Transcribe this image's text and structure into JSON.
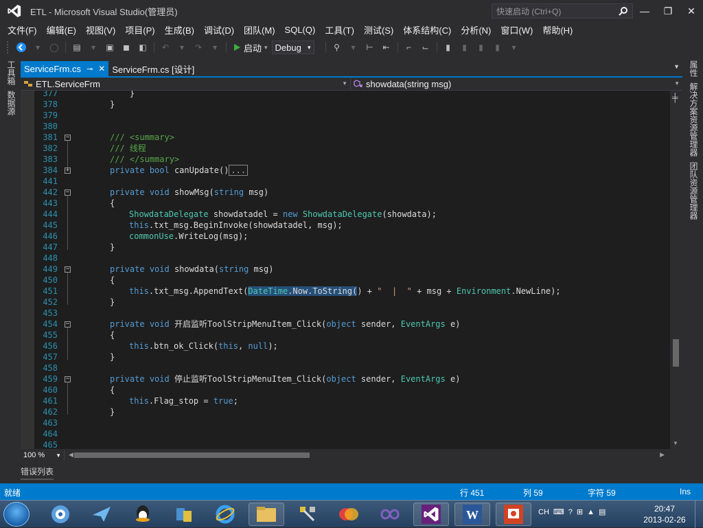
{
  "window": {
    "title": "ETL - Microsoft Visual Studio(管理员)",
    "quick_launch_placeholder": "快速启动 (Ctrl+Q)"
  },
  "menu": [
    "文件(F)",
    "编辑(E)",
    "视图(V)",
    "项目(P)",
    "生成(B)",
    "调试(D)",
    "团队(M)",
    "SQL(Q)",
    "工具(T)",
    "测试(S)",
    "体系结构(C)",
    "分析(N)",
    "窗口(W)",
    "帮助(H)"
  ],
  "toolbar": {
    "start_label": "启动",
    "config": "Debug"
  },
  "left_panels": [
    "工具箱",
    "数据源"
  ],
  "right_panels": [
    "属性",
    "解决方案资源管理器",
    "团队资源管理器"
  ],
  "tabs": [
    {
      "label": "ServiceFrm.cs",
      "active": true
    },
    {
      "label": "ServiceFrm.cs [设计]",
      "active": false
    }
  ],
  "nav": {
    "type": "ETL.ServiceFrm",
    "member": "showdata(string msg)"
  },
  "editor": {
    "lines": [
      {
        "n": "377",
        "code": "    }"
      },
      {
        "n": "378",
        "code": "}"
      },
      {
        "n": "379",
        "code": ""
      },
      {
        "n": "380",
        "code": ""
      },
      {
        "n": "381",
        "code": "/// <summary>"
      },
      {
        "n": "382",
        "code": "/// 线程"
      },
      {
        "n": "383",
        "code": "/// </summary>"
      },
      {
        "n": "384",
        "code": "private bool canUpdate()..."
      },
      {
        "n": "441",
        "code": ""
      },
      {
        "n": "442",
        "code": "private void showMsg(string msg)"
      },
      {
        "n": "443",
        "code": "{"
      },
      {
        "n": "444",
        "code": "ShowdataDelegate showdatadel = new ShowdataDelegate(showdata);"
      },
      {
        "n": "445",
        "code": "this.txt_msg.BeginInvoke(showdatadel, msg);"
      },
      {
        "n": "446",
        "code": "commonUse.WriteLog(msg);"
      },
      {
        "n": "447",
        "code": "}"
      },
      {
        "n": "448",
        "code": ""
      },
      {
        "n": "449",
        "code": "private void showdata(string msg)"
      },
      {
        "n": "450",
        "code": "{"
      },
      {
        "n": "451",
        "code": "this.txt_msg.AppendText(DateTime.Now.ToString() + \"  |  \" + msg + Environment.NewLine);"
      },
      {
        "n": "452",
        "code": "}"
      },
      {
        "n": "453",
        "code": ""
      },
      {
        "n": "454",
        "code": "private void 开启监听ToolStripMenuItem_Click(object sender, EventArgs e)"
      },
      {
        "n": "455",
        "code": "{"
      },
      {
        "n": "456",
        "code": "this.btn_ok_Click(this, null);"
      },
      {
        "n": "457",
        "code": "}"
      },
      {
        "n": "458",
        "code": ""
      },
      {
        "n": "459",
        "code": "private void 停止监听ToolStripMenuItem_Click(object sender, EventArgs e)"
      },
      {
        "n": "460",
        "code": "{"
      },
      {
        "n": "461",
        "code": "this.Flag_stop = true;"
      },
      {
        "n": "462",
        "code": "}"
      },
      {
        "n": "463",
        "code": ""
      },
      {
        "n": "464",
        "code": ""
      },
      {
        "n": "465",
        "code": ""
      }
    ],
    "zoom": "100 %"
  },
  "bottom_panel_tab": "错误列表",
  "status": {
    "ready": "就绪",
    "line": "行 451",
    "col": "列 59",
    "char": "字符 59",
    "mode": "Ins"
  },
  "tray": {
    "lang": "CH",
    "time": "20:47",
    "date": "2013-02-26"
  },
  "colors": {
    "accent": "#007acc",
    "keyword": "#569cd6",
    "type": "#4ec9b0",
    "comment": "#57a64a",
    "line_number": "#2b91af"
  }
}
